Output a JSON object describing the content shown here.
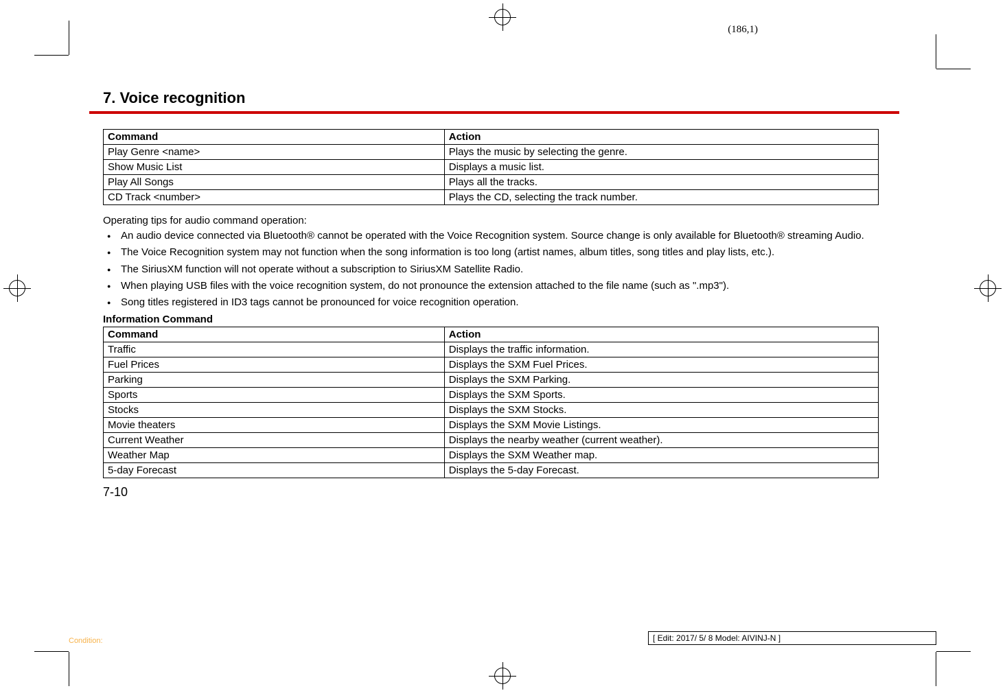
{
  "page_coord": "(186,1)",
  "section_title": "7. Voice recognition",
  "table1": {
    "headers": [
      "Command",
      "Action"
    ],
    "rows": [
      [
        "Play Genre <name>",
        "Plays the music by selecting the genre."
      ],
      [
        "Show Music List",
        "Displays a music list."
      ],
      [
        "Play All Songs",
        "Plays all the tracks."
      ],
      [
        "CD Track <number>",
        "Plays the CD, selecting the track number."
      ]
    ]
  },
  "tips_intro": "Operating tips for audio command operation:",
  "tips": [
    "An audio device connected via Bluetooth® cannot be operated with the Voice Recognition system. Source change is only available for Bluetooth® streaming Audio.",
    "The Voice Recognition system may not function when the song information is too long (artist names, album titles, song titles and play lists, etc.).",
    "The SiriusXM function will not operate without a subscription to SiriusXM Satellite Radio.",
    "When playing USB files with the voice recognition system, do not pronounce the extension attached to the file name (such as \".mp3\").",
    "Song titles registered in ID3 tags cannot be pronounced for voice recognition operation."
  ],
  "subhead": "Information Command",
  "table2": {
    "headers": [
      "Command",
      "Action"
    ],
    "rows": [
      [
        "Traffic",
        "Displays the traffic information."
      ],
      [
        "Fuel Prices",
        "Displays the SXM Fuel Prices."
      ],
      [
        "Parking",
        "Displays the SXM Parking."
      ],
      [
        "Sports",
        "Displays the SXM Sports."
      ],
      [
        "Stocks",
        "Displays the SXM Stocks."
      ],
      [
        "Movie theaters",
        "Displays the SXM Movie Listings."
      ],
      [
        "Current Weather",
        "Displays the nearby weather (current weather)."
      ],
      [
        "Weather Map",
        "Displays the SXM Weather map."
      ],
      [
        "5-day Forecast",
        "Displays the 5-day Forecast."
      ]
    ]
  },
  "page_number": "7-10",
  "footer_left": "Condition:",
  "footer_right": "[ Edit: 2017/ 5/ 8   Model:  AIVINJ-N ]"
}
